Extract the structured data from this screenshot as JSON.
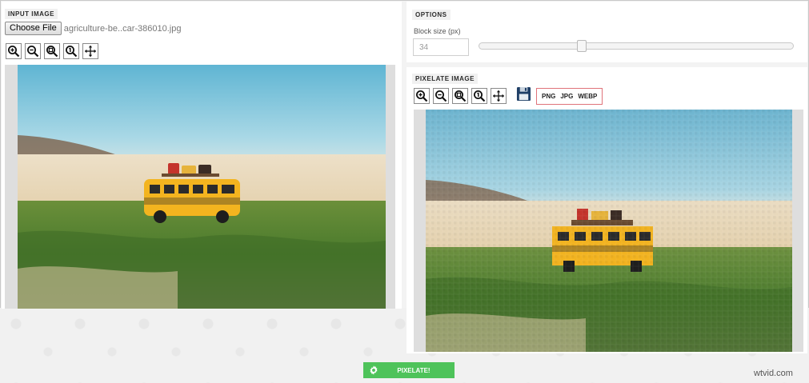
{
  "input_panel": {
    "title": "INPUT IMAGE",
    "choose_file_label": "Choose File",
    "file_name": "agriculture-be..car-386010.jpg",
    "toolbar": [
      "zoom-in-icon",
      "zoom-out-icon",
      "zoom-fit-icon",
      "zoom-actual-icon",
      "move-icon"
    ]
  },
  "options_panel": {
    "title": "OPTIONS",
    "block_size_label": "Block size (px)",
    "block_size_value": "34",
    "slider_fraction": 0.32
  },
  "pixelate_panel": {
    "title": "PIXELATE IMAGE",
    "toolbar": [
      "zoom-in-icon",
      "zoom-out-icon",
      "zoom-fit-icon",
      "zoom-actual-icon",
      "move-icon"
    ],
    "save_icon": "floppy-disk-icon",
    "formats": [
      "PNG",
      "JPG",
      "WEBP"
    ]
  },
  "pixelate_button": {
    "label": "PIXELATE!",
    "icon": "gear-icon"
  },
  "watermark": "wtvid.com",
  "colors": {
    "pixelate_button": "#4ec35a",
    "formats_border": "#e0737a"
  }
}
